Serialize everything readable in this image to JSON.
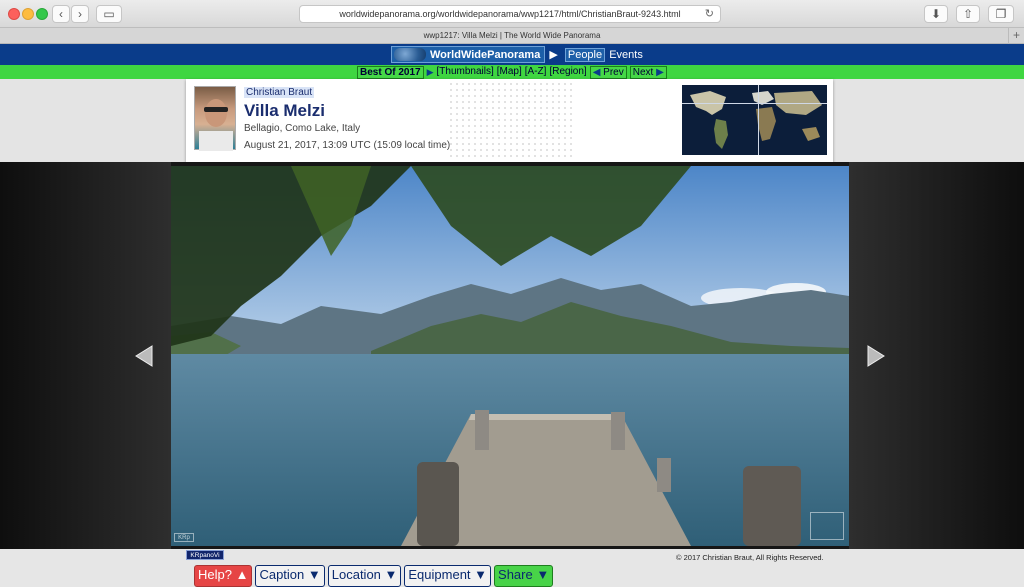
{
  "browser": {
    "url": "worldwidepanorama.org/worldwidepanorama/wwp1217/html/ChristianBraut-9243.html",
    "tab_title": "wwp1217: Villa Melzi | The World Wide Panorama"
  },
  "site_nav": {
    "brand": "WorldWidePanorama",
    "items": [
      "People",
      "Events"
    ]
  },
  "sub_nav": {
    "best": "Best Of 2017",
    "thumbnails": "[Thumbnails]",
    "map": "[Map]",
    "az": "[A-Z]",
    "region": "[Region]",
    "prev": "Prev",
    "next": "Next"
  },
  "header": {
    "author": "Christian Braut",
    "title": "Villa Melzi",
    "location": "Bellagio, Como Lake, Italy",
    "datetime": "August 21, 2017, 13:09 UTC (15:09 local time)"
  },
  "footer": {
    "krpano": "KRpanoVi",
    "watermark": "KRp",
    "copyright": "© 2017 Christian Braut, All Rights Reserved."
  },
  "buttons": {
    "help": "Help? ▲",
    "caption": "Caption ▼",
    "location": "Location ▼",
    "equipment": "Equipment ▼",
    "share": "Share ▼"
  },
  "colors": {
    "nav_blue": "#0a3c8a",
    "nav_green": "#3fd641",
    "title_blue": "#1a2d6e"
  }
}
